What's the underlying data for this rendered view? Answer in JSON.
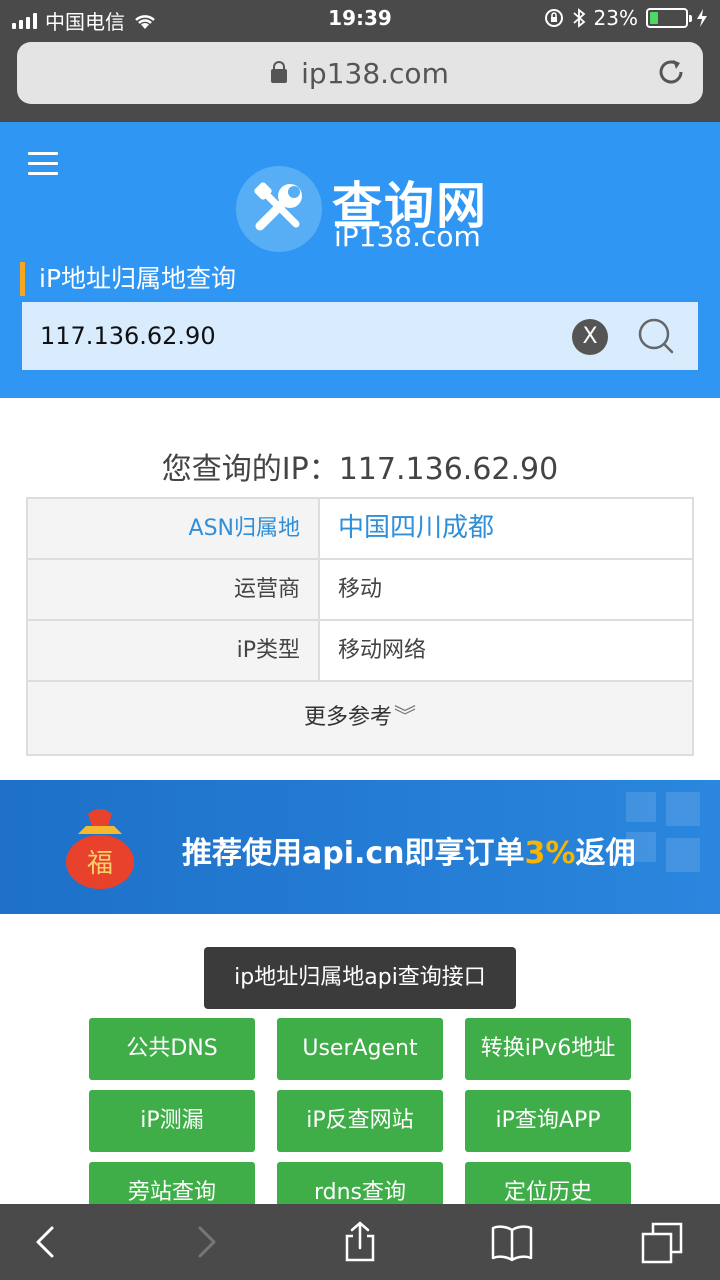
{
  "status": {
    "carrier": "中国电信",
    "time": "19:39",
    "battery": "23%",
    "battery_level": 0.23
  },
  "browser": {
    "url": "ip138.com"
  },
  "header": {
    "logo_title": "查询网",
    "logo_sub": "iP138.com",
    "section_label": "iP地址归属地查询",
    "search_value": "117.136.62.90",
    "clear_label": "X"
  },
  "result": {
    "title": "您查询的IP：117.136.62.90",
    "rows": [
      {
        "key": "ASN归属地",
        "value": "中国四川成都"
      },
      {
        "key": "运营商",
        "value": "移动"
      },
      {
        "key": "iP类型",
        "value": "移动网络"
      }
    ],
    "more": "更多参考"
  },
  "banner": {
    "text_prefix": "推荐使用api.cn即享订单",
    "text_pct": "3%",
    "text_suffix": "返佣",
    "bag_char": "福"
  },
  "api_tip": "ip地址归属地api查询接口",
  "links": [
    "公共DNS",
    "UserAgent",
    "转换iPv6地址",
    "iP测漏",
    "iP反查网站",
    "iP查询APP",
    "旁站查询",
    "rdns查询",
    "定位历史"
  ],
  "colors": {
    "header_blue": "#2f97f3",
    "green": "#3fae49",
    "accent_orange": "#f5a623"
  }
}
